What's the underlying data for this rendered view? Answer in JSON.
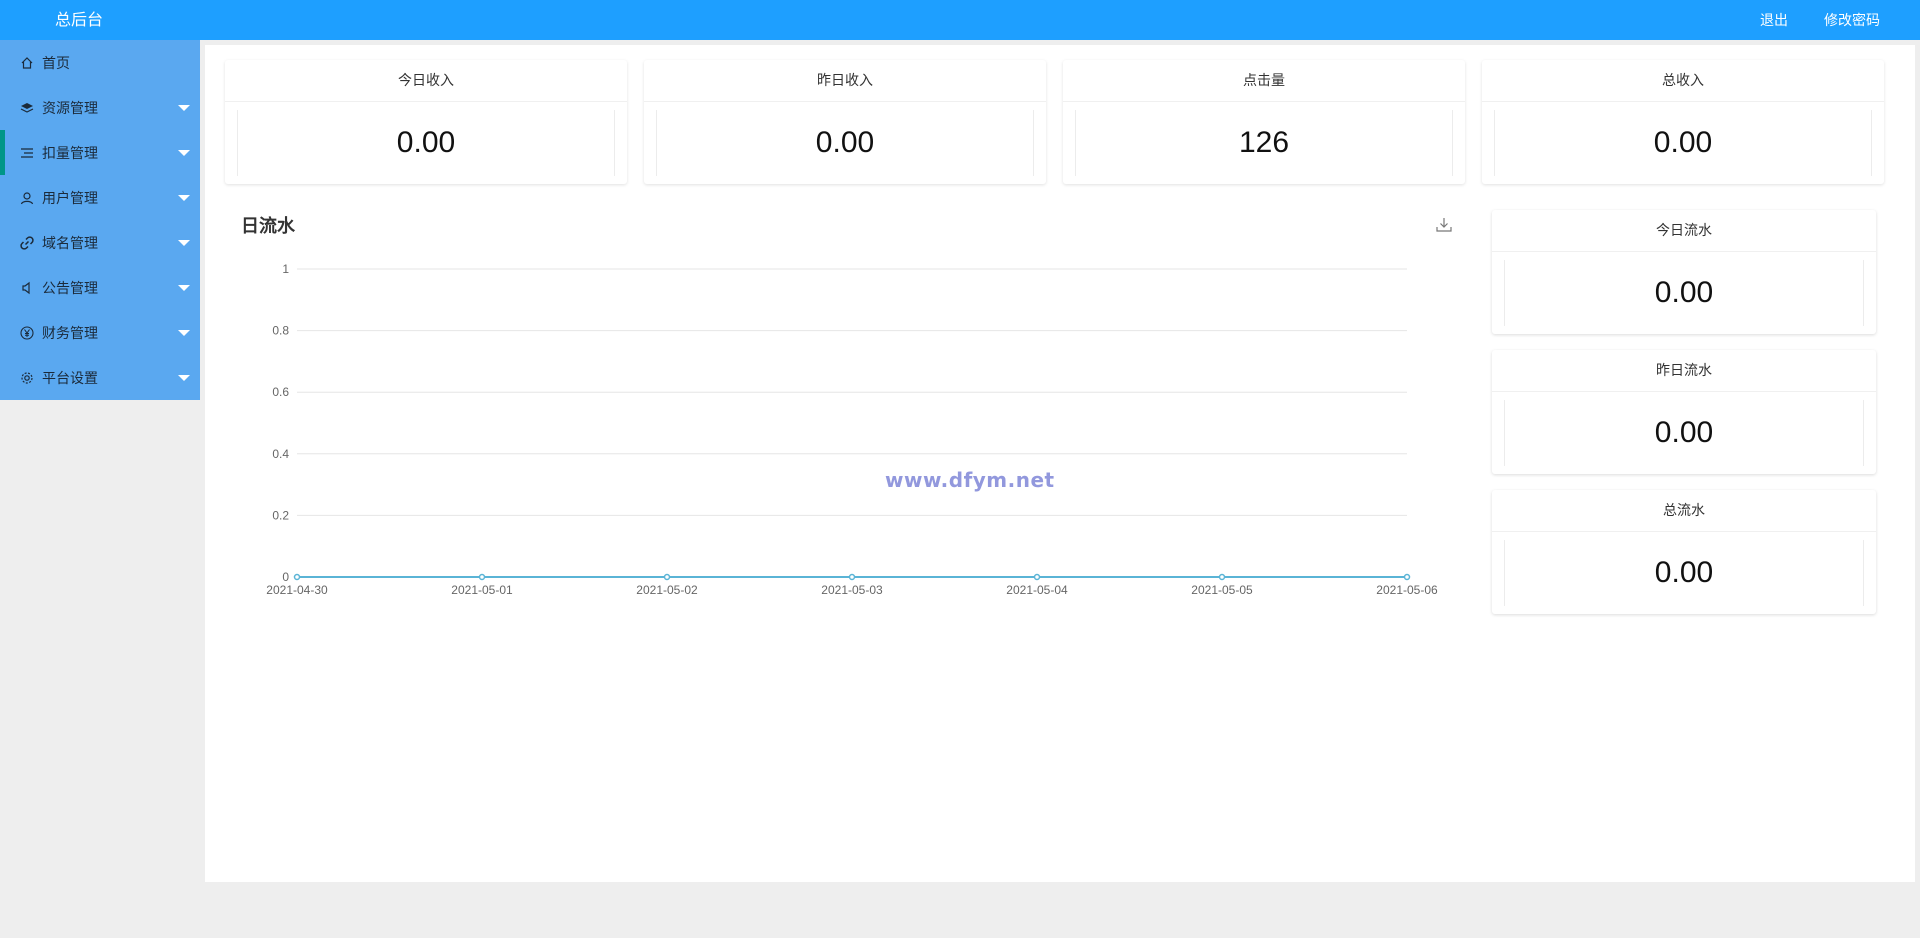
{
  "header": {
    "brand": "总后台",
    "links": [
      "退出",
      "修改密码"
    ]
  },
  "sidebar": {
    "items": [
      {
        "label": "首页",
        "icon": "home-icon",
        "expandable": false
      },
      {
        "label": "资源管理",
        "icon": "layers-icon",
        "expandable": true
      },
      {
        "label": "扣量管理",
        "icon": "list-icon",
        "expandable": true,
        "active": true
      },
      {
        "label": "用户管理",
        "icon": "user-icon",
        "expandable": true
      },
      {
        "label": "域名管理",
        "icon": "link-icon",
        "expandable": true
      },
      {
        "label": "公告管理",
        "icon": "speaker-icon",
        "expandable": true
      },
      {
        "label": "财务管理",
        "icon": "yen-icon",
        "expandable": true
      },
      {
        "label": "平台设置",
        "icon": "gear-icon",
        "expandable": true
      }
    ]
  },
  "stats": [
    {
      "title": "今日收入",
      "value": "0.00"
    },
    {
      "title": "昨日收入",
      "value": "0.00"
    },
    {
      "title": "点击量",
      "value": "126"
    },
    {
      "title": "总收入",
      "value": "0.00"
    }
  ],
  "flow_cards": [
    {
      "title": "今日流水",
      "value": "0.00"
    },
    {
      "title": "昨日流水",
      "value": "0.00"
    },
    {
      "title": "总流水",
      "value": "0.00"
    }
  ],
  "watermark": "www.dfym.net",
  "colors": {
    "header": "#1e9fff",
    "sidebar": "#5aa8f0",
    "active_marker": "#009688",
    "line": "#5ab4d6"
  },
  "chart_data": {
    "type": "line",
    "title": "日流水",
    "x": [
      "2021-04-30",
      "2021-05-01",
      "2021-05-02",
      "2021-05-03",
      "2021-05-04",
      "2021-05-05",
      "2021-05-06"
    ],
    "series": [
      {
        "values": [
          0,
          0,
          0,
          0,
          0,
          0,
          0
        ]
      }
    ],
    "yticks": [
      "0",
      "0.2",
      "0.4",
      "0.6",
      "0.8",
      "1"
    ],
    "ylim": [
      0,
      1
    ],
    "grid": true
  }
}
